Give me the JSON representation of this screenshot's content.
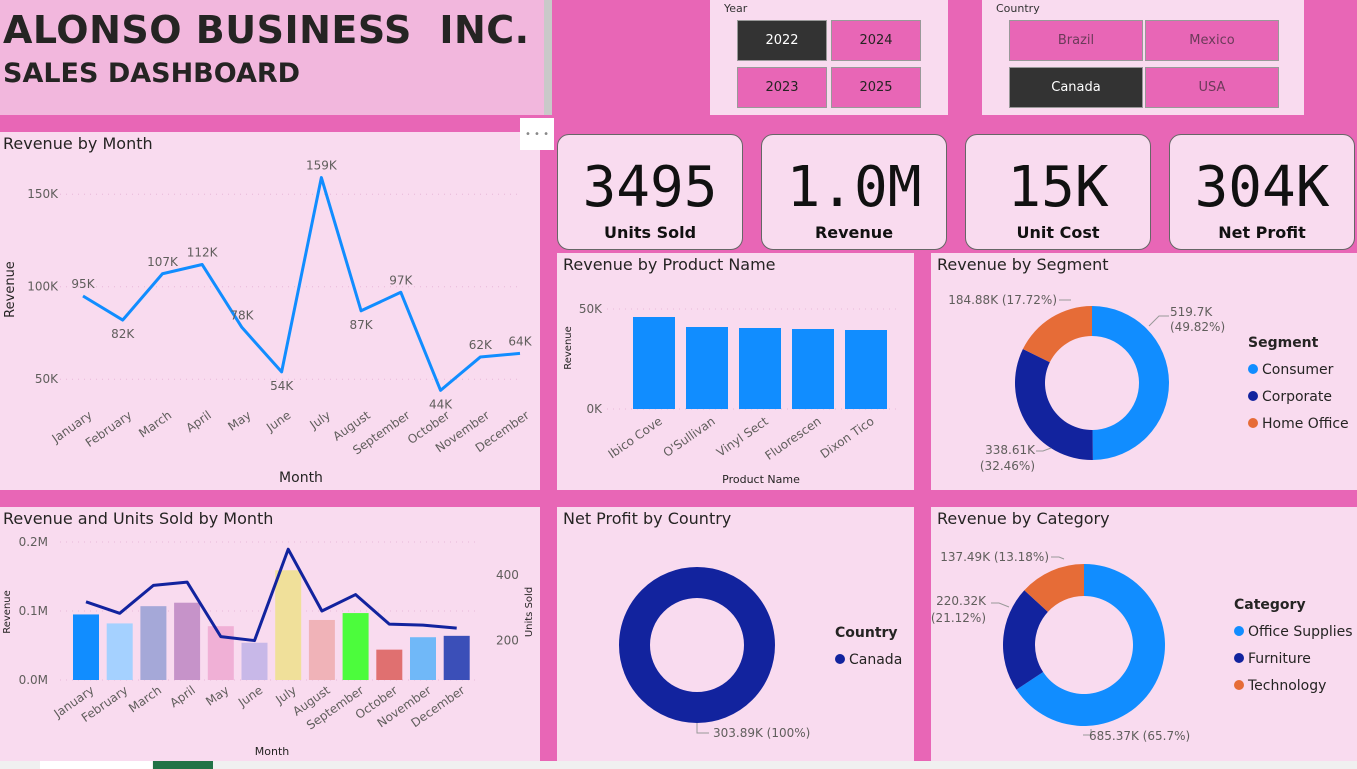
{
  "header": {
    "title": "ALONSO BUSINESS  INC.",
    "subtitle": "SALES DASHBOARD"
  },
  "year_slicer": {
    "label": "Year",
    "options": [
      "2022",
      "2024",
      "2023",
      "2025"
    ],
    "selected": "2022"
  },
  "country_slicer": {
    "label": "Country",
    "options": [
      "Brazil",
      "Mexico",
      "Canada",
      "USA"
    ],
    "selected": "Canada"
  },
  "kpis": [
    {
      "value": "3495",
      "label": "Units Sold"
    },
    {
      "value": "1.0M",
      "label": "Revenue"
    },
    {
      "value": "15K",
      "label": "Unit Cost"
    },
    {
      "value": "304K",
      "label": "Net Profit"
    }
  ],
  "colors": {
    "background": "#e866b6",
    "panel": "#f9dbef",
    "line": "#118dff",
    "dark_blue": "#12239e",
    "orange": "#e66c37"
  },
  "chart_data": [
    {
      "id": "revenue_by_month",
      "type": "line",
      "title": "Revenue by Month",
      "xlabel": "Month",
      "ylabel": "Revenue",
      "categories": [
        "January",
        "February",
        "March",
        "April",
        "May",
        "June",
        "July",
        "August",
        "September",
        "October",
        "November",
        "December"
      ],
      "values": [
        95,
        82,
        107,
        112,
        78,
        54,
        159,
        87,
        97,
        44,
        62,
        64
      ],
      "data_labels": [
        "95K",
        "82K",
        "107K",
        "112K",
        "78K",
        "54K",
        "159K",
        "87K",
        "97K",
        "44K",
        "62K",
        "64K"
      ],
      "y_ticks": [
        50,
        100,
        150
      ],
      "y_tick_labels": [
        "50K",
        "100K",
        "150K"
      ],
      "ylim": [
        35,
        162
      ]
    },
    {
      "id": "revenue_by_product",
      "type": "bar",
      "title": "Revenue by Product Name",
      "xlabel": "Product Name",
      "ylabel": "Revenue",
      "categories": [
        "Ibico Cove",
        "O'Sullivan",
        "Vinyl Sect",
        "Fluorescen",
        "Dixon Tico"
      ],
      "values": [
        46,
        41,
        40.5,
        40,
        39.5
      ],
      "y_ticks": [
        0,
        50
      ],
      "y_tick_labels": [
        "0K",
        "50K"
      ],
      "ylim": [
        0,
        50
      ]
    },
    {
      "id": "revenue_by_segment",
      "type": "pie",
      "title": "Revenue by Segment",
      "legend_title": "Segment",
      "labels": [
        "Consumer",
        "Corporate",
        "Home Office"
      ],
      "values": [
        519.7,
        338.61,
        184.88
      ],
      "percents": [
        49.82,
        32.46,
        17.72
      ],
      "value_labels": [
        "519.7K",
        "338.61K",
        "184.88K"
      ],
      "percent_labels": [
        "(49.82%)",
        "(32.46%)",
        "(17.72%)"
      ],
      "colors": [
        "#118dff",
        "#12239e",
        "#e66c37"
      ]
    },
    {
      "id": "revenue_units_by_month",
      "type": "bar",
      "title": "Revenue and Units Sold by Month",
      "xlabel": "Month",
      "ylabel": "Revenue",
      "y2label": "Units Sold",
      "categories": [
        "January",
        "February",
        "March",
        "April",
        "May",
        "June",
        "July",
        "August",
        "September",
        "October",
        "November",
        "December"
      ],
      "series": [
        {
          "name": "Revenue",
          "values": [
            95,
            82,
            107,
            112,
            78,
            54,
            159,
            87,
            97,
            44,
            62,
            64
          ]
        },
        {
          "name": "Units Sold",
          "values": [
            318,
            283,
            368,
            378,
            212,
            200,
            478,
            290,
            340,
            250,
            247,
            238
          ]
        }
      ],
      "bar_colors": [
        "#118dff",
        "#a5d1ff",
        "#a5a8d8",
        "#c693c9",
        "#f0b0d6",
        "#c8b8e8",
        "#f0e09a",
        "#f0b3b8",
        "#4cfc3c",
        "#e07070",
        "#70b8f8",
        "#3b4fb8"
      ],
      "y_ticks": [
        0,
        100,
        200
      ],
      "y_tick_labels": [
        "0.0M",
        "0.1M",
        "0.2M"
      ],
      "ylim": [
        0,
        200
      ],
      "y2_ticks": [
        200,
        400
      ],
      "y2_tick_labels": [
        "200",
        "400"
      ],
      "y2lim": [
        80,
        500
      ]
    },
    {
      "id": "net_profit_by_country",
      "type": "pie",
      "title": "Net Profit by Country",
      "legend_title": "Country",
      "labels": [
        "Canada"
      ],
      "values": [
        303.89
      ],
      "percents": [
        100
      ],
      "value_labels": [
        "303.89K (100%)"
      ],
      "colors": [
        "#12239e"
      ]
    },
    {
      "id": "revenue_by_category",
      "type": "pie",
      "title": "Revenue by Category",
      "legend_title": "Category",
      "labels": [
        "Office Supplies",
        "Furniture",
        "Technology"
      ],
      "values": [
        685.37,
        220.32,
        137.49
      ],
      "percents": [
        65.7,
        21.12,
        13.18
      ],
      "value_labels": [
        "685.37K",
        "220.32K",
        "137.49K"
      ],
      "percent_labels": [
        "(65.7%)",
        "(21.12%)",
        "(13.18%)"
      ],
      "colors": [
        "#118dff",
        "#12239e",
        "#e66c37"
      ]
    }
  ]
}
